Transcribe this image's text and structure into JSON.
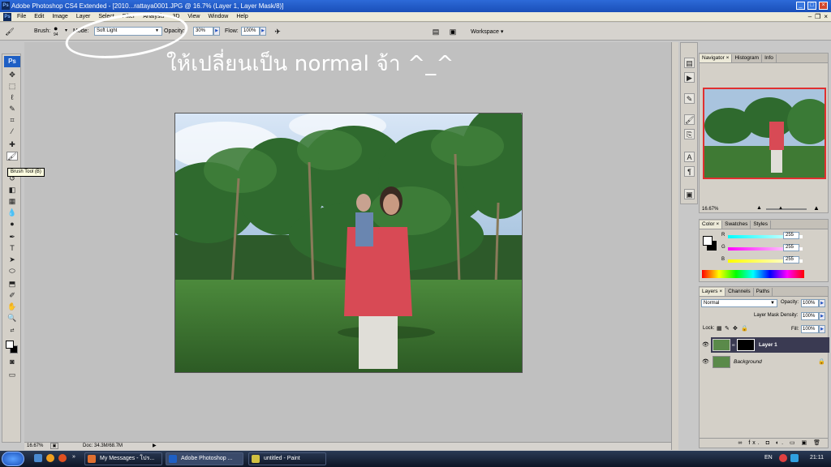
{
  "window": {
    "title": "Adobe Photoshop CS4 Extended - [2010...rattaya0001.JPG @ 16.7% (Layer 1, Layer Mask/8)]",
    "ps_icon": "Ps"
  },
  "menu": [
    "File",
    "Edit",
    "Image",
    "Layer",
    "Select",
    "Filter",
    "Analysis",
    "3D",
    "View",
    "Window",
    "Help"
  ],
  "options": {
    "brush_label": "Brush:",
    "brush_size": "94",
    "mode_label": "Mode:",
    "mode_value": "Soft Light",
    "opacity_label": "Opacity:",
    "opacity_value": "30%",
    "flow_label": "Flow:",
    "flow_value": "100%",
    "workspace_label": "Workspace ▾"
  },
  "toolbox": {
    "logo": "Ps",
    "tooltip": "Brush Tool (B)"
  },
  "annotation": {
    "text": "ให้เปลี่ยนเป็น normal จ้า ^_^"
  },
  "status": {
    "zoom": "16.67%",
    "doc": "Doc: 34.3M/68.7M"
  },
  "navigator": {
    "tabs": [
      "Navigator",
      "Histogram",
      "Info"
    ],
    "zoom": "16.67%"
  },
  "color_panel": {
    "tabs": [
      "Color",
      "Swatches",
      "Styles"
    ],
    "r_label": "R",
    "g_label": "G",
    "b_label": "B",
    "r": "255",
    "g": "255",
    "b": "255"
  },
  "layers_panel": {
    "tabs": [
      "Layers",
      "Channels",
      "Paths"
    ],
    "blend_mode": "Normal",
    "opacity_label": "Opacity:",
    "opacity_value": "100%",
    "mask_density_label": "Layer Mask Density:",
    "mask_density_value": "100%",
    "lock_label": "Lock:",
    "fill_label": "Fill:",
    "fill_value": "100%",
    "layers": [
      {
        "name": "Layer 1",
        "selected": true
      },
      {
        "name": "Background",
        "selected": false
      }
    ],
    "footer_icons": "∞ fx. ◘ ◐. ▭ ▣ 🗑"
  },
  "taskbar": {
    "items": [
      "My Messages - โปร...",
      "Adobe Photoshop ...",
      "untitled - Paint"
    ],
    "lang": "EN",
    "time": "21:11"
  },
  "colors": {
    "accent": "#e03030",
    "selected_layer": "#3a3a52",
    "taskbar": "#0e1626"
  }
}
